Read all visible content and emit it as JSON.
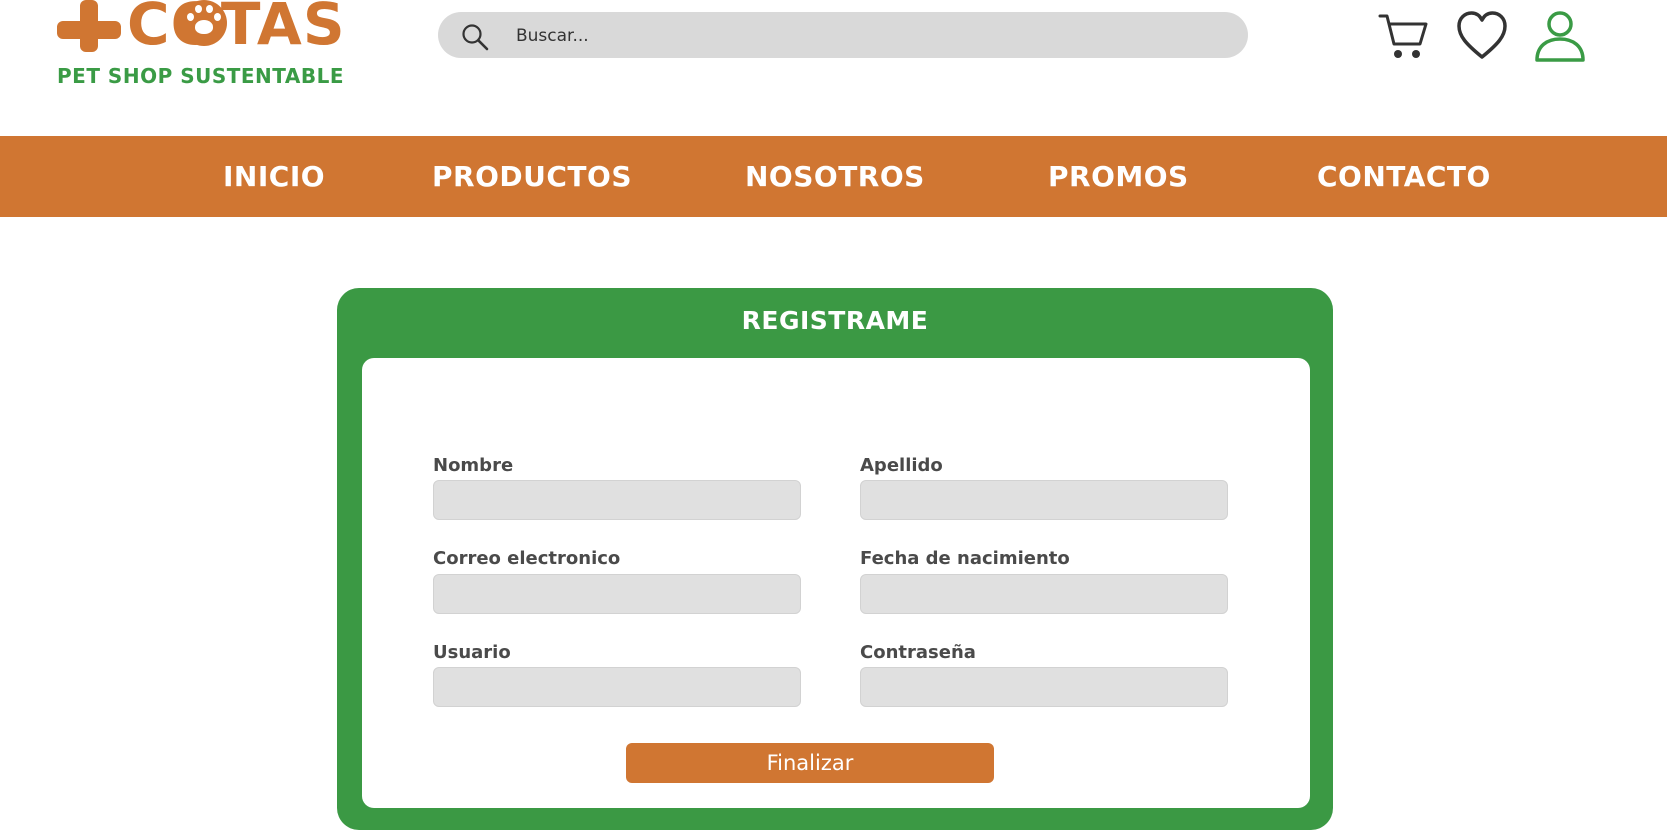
{
  "brand": {
    "name": "COTAS",
    "tagline": "PET SHOP SUSTENTABLE",
    "primary_color": "#d07632",
    "secondary_color": "#3a9b45",
    "logo_icons": [
      "plus-icon",
      "paw-icon"
    ]
  },
  "search": {
    "placeholder": "Buscar...",
    "value": "",
    "icon": "search-icon"
  },
  "header_actions": [
    {
      "name": "cart",
      "icon": "cart-icon"
    },
    {
      "name": "favorites",
      "icon": "heart-icon"
    },
    {
      "name": "account",
      "icon": "user-icon"
    }
  ],
  "nav": {
    "background": "#d07632",
    "items": [
      {
        "label": "INICIO"
      },
      {
        "label": "PRODUCTOS"
      },
      {
        "label": "NOSOTROS"
      },
      {
        "label": "PROMOS"
      },
      {
        "label": "CONTACTO"
      }
    ]
  },
  "register": {
    "title": "REGISTRAME",
    "card_color": "#3b9944",
    "fields": [
      {
        "label": "Nombre",
        "value": ""
      },
      {
        "label": "Apellido",
        "value": ""
      },
      {
        "label": "Correo electronico",
        "value": ""
      },
      {
        "label": "Fecha de nacimiento",
        "value": ""
      },
      {
        "label": "Usuario",
        "value": ""
      },
      {
        "label": "Contraseña",
        "value": ""
      }
    ],
    "submit_label": "Finalizar",
    "submit_color": "#d07632"
  }
}
